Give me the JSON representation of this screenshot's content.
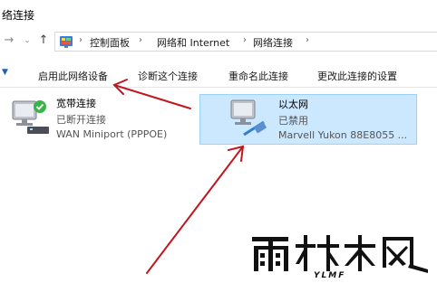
{
  "window": {
    "title": "络连接"
  },
  "address": {
    "crumbs": [
      "控制面板",
      "网络和 Internet",
      "网络连接"
    ]
  },
  "toolbar": {
    "items": [
      "启用此网络设备",
      "诊断这个连接",
      "重命名此连接",
      "更改此连接的设置"
    ]
  },
  "connections": [
    {
      "name": "宽带连接",
      "status": "已断开连接",
      "device": "WAN Miniport (PPPOE)",
      "icon": "dialup-connection-icon",
      "selected": false
    },
    {
      "name": "以太网",
      "status": "已禁用",
      "device": "Marvell Yukon 88E8055 ...",
      "icon": "ethernet-adapter-icon",
      "selected": true
    }
  ],
  "watermark": {
    "text": "雨林木风",
    "subtext": "YLMF"
  },
  "colors": {
    "selection_bg": "#cce8ff",
    "selection_border": "#99d1ff",
    "annotation_arrow": "#c0161f",
    "status_ok": "#3cb34a"
  }
}
